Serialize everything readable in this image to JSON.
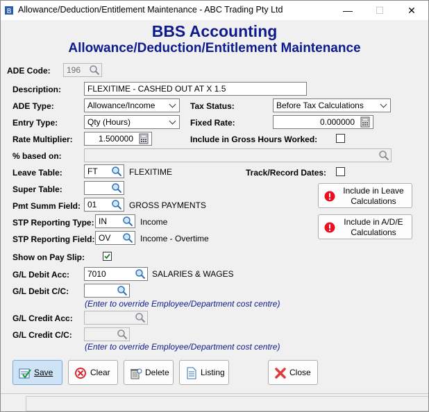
{
  "window": {
    "title": "Allowance/Deduction/Entitlement Maintenance - ABC Trading Pty Ltd",
    "min_glyph": "—",
    "max_glyph": "☐",
    "close_glyph": "✕"
  },
  "header": {
    "line1": "BBS Accounting",
    "line2": "Allowance/Deduction/Entitlement Maintenance"
  },
  "form": {
    "ade_code": {
      "label": "ADE Code:",
      "value": "196"
    },
    "description": {
      "label": "Description:",
      "value": "FLEXITIME - CASHED OUT AT X 1.5"
    },
    "ade_type": {
      "label": "ADE Type:",
      "value": "Allowance/Income"
    },
    "tax_status": {
      "label": "Tax Status:",
      "value": "Before Tax Calculations"
    },
    "entry_type": {
      "label": "Entry Type:",
      "value": "Qty (Hours)"
    },
    "fixed_rate": {
      "label": "Fixed Rate:",
      "value": "0.000000"
    },
    "rate_multiplier": {
      "label": "Rate Multiplier:",
      "value": "1.500000"
    },
    "gross_hours": {
      "label": "Include in Gross Hours Worked:",
      "checked": false
    },
    "based_on": {
      "label": "% based on:",
      "value": ""
    },
    "leave_table": {
      "label": "Leave Table:",
      "value": "FT",
      "desc": "FLEXITIME"
    },
    "track_dates": {
      "label": "Track/Record Dates:",
      "checked": false
    },
    "super_table": {
      "label": "Super Table:",
      "value": ""
    },
    "pmt_summ": {
      "label": "Pmt Summ Field:",
      "value": "01",
      "desc": "GROSS PAYMENTS"
    },
    "stp_type": {
      "label": "STP Reporting Type:",
      "value": "IN",
      "desc": "Income"
    },
    "stp_field": {
      "label": "STP Reporting Field:",
      "value": "OV",
      "desc": "Income - Overtime"
    },
    "show_payslip": {
      "label": "Show on Pay Slip:",
      "checked": true
    },
    "gl_debit_acc": {
      "label": "G/L Debit Acc:",
      "value": "7010",
      "desc": "SALARIES & WAGES"
    },
    "gl_debit_cc": {
      "label": "G/L Debit C/C:",
      "value": "",
      "note": "(Enter to override Employee/Department cost centre)"
    },
    "gl_credit_acc": {
      "label": "G/L Credit Acc:",
      "value": ""
    },
    "gl_credit_cc": {
      "label": "G/L Credit C/C:",
      "value": "",
      "note": "(Enter to override Employee/Department cost centre)"
    }
  },
  "side_buttons": {
    "include_leave": {
      "line1": "Include in Leave",
      "line2": "Calculations"
    },
    "include_ade": {
      "line1": "Include in A/D/E",
      "line2": "Calculations"
    }
  },
  "toolbar": {
    "save": "Save",
    "clear": "Clear",
    "delete": "Delete",
    "listing": "Listing",
    "close": "Close"
  },
  "colors": {
    "header_blue": "#0d1a8c",
    "warning_red": "#e81123",
    "save_highlight": "#cfe3f7"
  }
}
